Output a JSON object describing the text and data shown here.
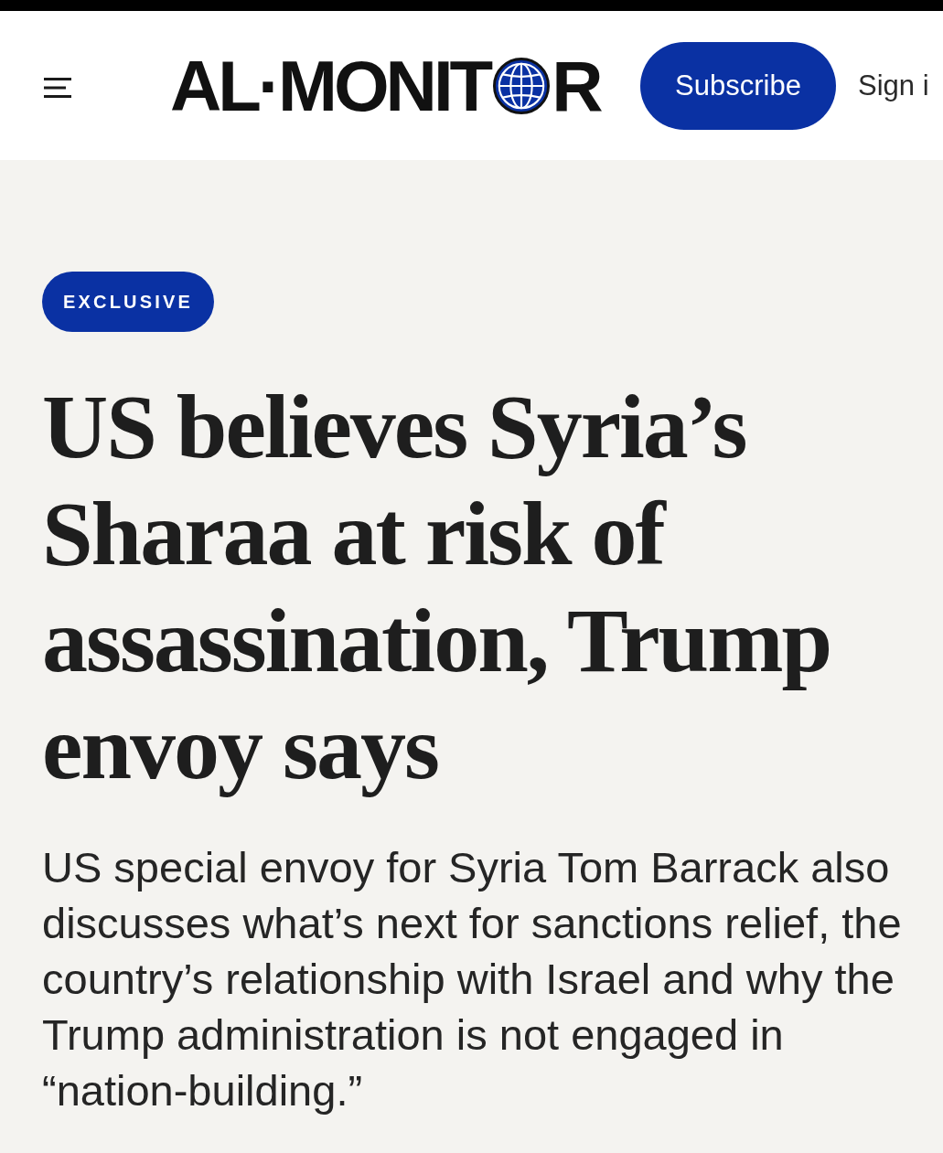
{
  "header": {
    "logo": {
      "text_before_globe": "AL·MONIT",
      "text_after_globe": "R"
    },
    "subscribe_button": "Subscribe",
    "sign_in_link": "Sign i"
  },
  "article": {
    "label": "EXCLUSIVE",
    "headline": "US believes Syria’s Sharaa at risk of assassination, Trump envoy says",
    "dek": "US special envoy for Syria Tom Barrack also discusses what’s next for sanctions relief, the country’s relationship with Israel and why the Trump administration is not engaged in “nation-building.”"
  }
}
